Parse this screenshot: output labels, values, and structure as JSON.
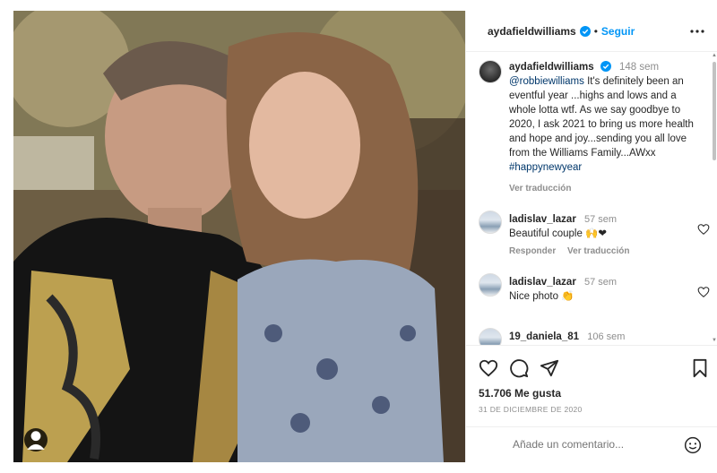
{
  "post": {
    "username": "aydafieldwilliams",
    "follow_label": "Seguir",
    "separator": "•"
  },
  "caption": {
    "username": "aydafieldwilliams",
    "time": "148 sem",
    "mention": "@robbiewilliams",
    "text": " It's definitely been an eventful year ...highs and lows and a whole lotta wtf. As we say goodbye to 2020, I ask 2021 to bring us more health and hope and joy...sending you all love from the Williams Family...AWxx ",
    "hashtag": "#happynewyear",
    "see_translation": "Ver traducción"
  },
  "comments": [
    {
      "username": "ladislav_lazar",
      "time": "57 sem",
      "text": "Beautiful couple 🙌❤",
      "reply_label": "Responder",
      "translate_label": "Ver traducción"
    },
    {
      "username": "ladislav_lazar",
      "time": "57 sem",
      "text": "Nice photo 👏",
      "reply_label": "",
      "translate_label": ""
    },
    {
      "username": "19_daniela_81",
      "time": "106 sem",
      "text": "",
      "reply_label": "",
      "translate_label": ""
    }
  ],
  "footer": {
    "likes": "51.706 Me gusta",
    "date": "31 DE DICIEMBRE DE 2020",
    "comment_placeholder": "Añade un comentario..."
  },
  "colors": {
    "accent": "#0095f6",
    "text": "#262626",
    "muted": "#8e8e8e",
    "heart": "#ed4956"
  },
  "icons": [
    "verified-icon",
    "more-icon",
    "heart-icon",
    "comment-icon",
    "share-icon",
    "save-icon",
    "emoji-icon",
    "tagged-user-icon"
  ]
}
